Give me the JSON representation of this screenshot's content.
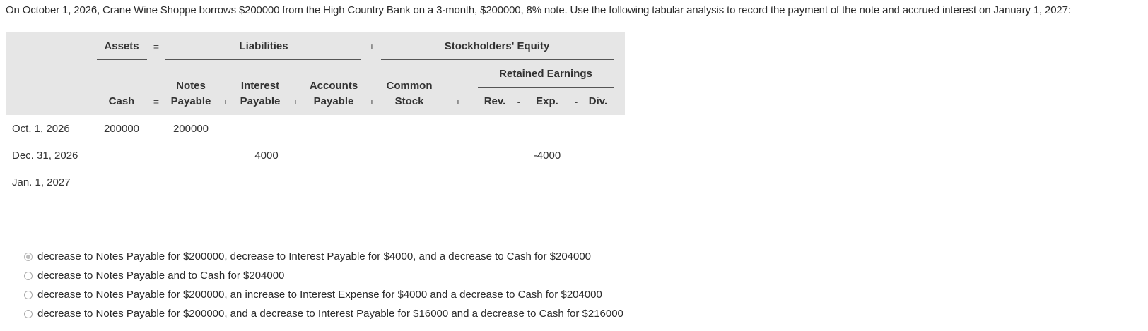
{
  "question": "On October 1, 2026, Crane Wine Shoppe borrows $200000 from the High Country Bank on a 3-month, $200000, 8% note. Use the following tabular analysis to record the payment of the note and accrued interest on January 1, 2027:",
  "table": {
    "top_headers": {
      "assets": "Assets",
      "eq1": "=",
      "liabilities": "Liabilities",
      "plus1": "+",
      "equity": "Stockholders' Equity",
      "retained": "Retained Earnings"
    },
    "columns": {
      "cash": "Cash",
      "eq2": "=",
      "notes_1": "Notes",
      "notes_2": "Payable",
      "plus_a": "+",
      "interest_1": "Interest",
      "interest_2": "Payable",
      "plus_b": "+",
      "accounts_1": "Accounts",
      "accounts_2": "Payable",
      "plus_c": "+",
      "common_1": "Common",
      "common_2": "Stock",
      "plus_d": "+",
      "rev": "Rev.",
      "minus_a": "-",
      "exp": "Exp.",
      "minus_b": "-",
      "div": "Div."
    },
    "rows": [
      {
        "label": "Oct. 1, 2026",
        "cash": "200000",
        "notes": "200000",
        "interest": "",
        "exp": ""
      },
      {
        "label": "Dec. 31, 2026",
        "cash": "",
        "notes": "",
        "interest": "4000",
        "exp": "-4000"
      },
      {
        "label": "Jan. 1, 2027",
        "cash": "",
        "notes": "",
        "interest": "",
        "exp": ""
      }
    ]
  },
  "options": [
    {
      "text": "decrease to Notes Payable for $200000, decrease to Interest Payable for $4000, and a decrease to Cash for $204000",
      "selected": true
    },
    {
      "text": "decrease to Notes Payable and to Cash for $204000",
      "selected": false
    },
    {
      "text": "decrease to Notes Payable for $200000, an increase to Interest Expense for $4000 and a decrease to Cash for $204000",
      "selected": false
    },
    {
      "text": "decrease to Notes Payable for $200000, and a decrease to Interest Payable for $16000 and a decrease to Cash for $216000",
      "selected": false
    }
  ]
}
